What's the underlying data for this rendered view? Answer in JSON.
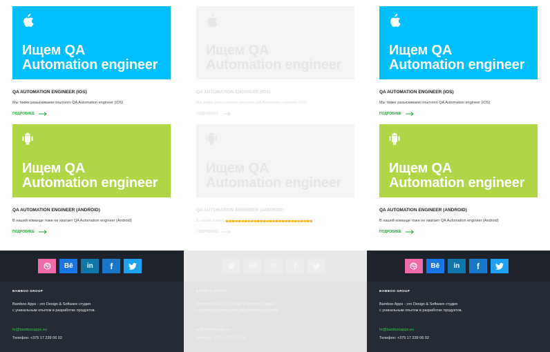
{
  "colors": {
    "ios_banner": "#00bfff",
    "android_banner": "#b0d645",
    "footer_dark": "#252b34",
    "link_green": "#1fa53a"
  },
  "cards": {
    "ios": {
      "icon": "apple-icon",
      "banner_title": "Ищем QA\nAutomation engineer",
      "title": "QA AUTOMATION ENGINEER (IOS)",
      "description": "Мы также разыскиваем опытного QA Automation engineer (iOS)",
      "more_label": "подробнее"
    },
    "android": {
      "icon": "android-icon",
      "banner_title": "Ищем QA\nAutomation engineer",
      "title": "QA AUTOMATION ENGINEER (ANDROID)",
      "description": "В нашей команде тоже не хватает QA Automation engineer (Android)",
      "more_label": "подробнее"
    }
  },
  "footer": {
    "social": [
      {
        "name": "dribbble-icon"
      },
      {
        "name": "behance-icon",
        "label": "Bē"
      },
      {
        "name": "linkedin-icon",
        "label": "in"
      },
      {
        "name": "facebook-icon",
        "label": "f"
      },
      {
        "name": "twitter-icon"
      }
    ],
    "brand": "BAMBOO GROUP",
    "about": "Bamboo Apps - это Design & Software студия\nс уникальным опытом в разработке продуктов.",
    "email": "hr@bambooapps.eu",
    "phone": "Телефон: +375 17 239 06 02"
  }
}
